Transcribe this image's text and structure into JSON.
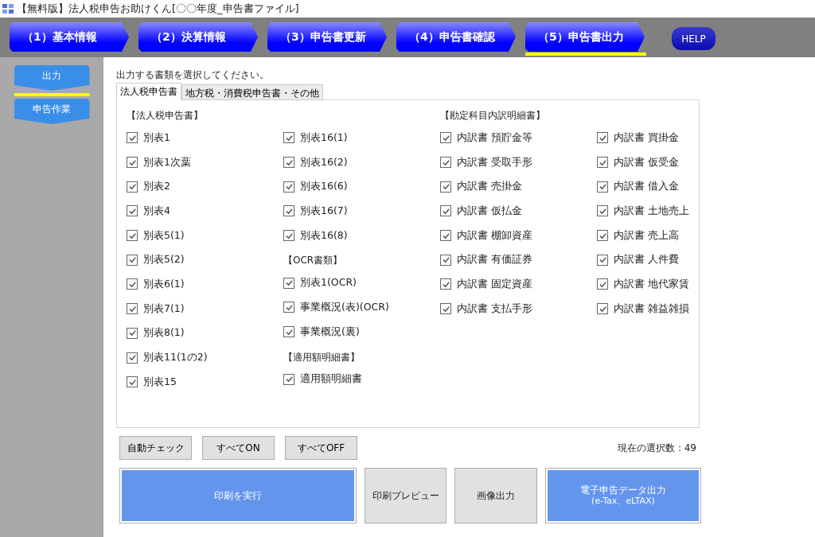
{
  "window": {
    "title": "【無料版】法人税申告お助けくん[〇〇年度_申告書ファイル]"
  },
  "steps": [
    {
      "label": "（1）基本情報",
      "selected": false
    },
    {
      "label": "（2）決算情報",
      "selected": false
    },
    {
      "label": "（3）申告書更新",
      "selected": false
    },
    {
      "label": "（4）申告書確認",
      "selected": false
    },
    {
      "label": "（5）申告書出力",
      "selected": true
    }
  ],
  "help_button": "HELP",
  "sidebar": {
    "items": [
      {
        "label": "出力",
        "selected": true
      },
      {
        "label": "申告作業",
        "selected": false
      }
    ]
  },
  "instruction": "出力する書類を選択してください。",
  "tabs": [
    {
      "label": "法人税申告書",
      "selected": true
    },
    {
      "label": "地方税・消費税申告書・その他",
      "selected": false
    }
  ],
  "columns": [
    {
      "sections": [
        {
          "heading": "【法人税申告書】",
          "items": [
            {
              "label": "別表1",
              "checked": true
            },
            {
              "label": "別表1次葉",
              "checked": true
            },
            {
              "label": "別表2",
              "checked": true
            },
            {
              "label": "別表4",
              "checked": true
            },
            {
              "label": "別表5(1)",
              "checked": true
            },
            {
              "label": "別表5(2)",
              "checked": true
            },
            {
              "label": "別表6(1)",
              "checked": true
            },
            {
              "label": "別表7(1)",
              "checked": true
            },
            {
              "label": "別表8(1)",
              "checked": true
            },
            {
              "label": "別表11(1の2)",
              "checked": true
            },
            {
              "label": "別表15",
              "checked": true
            }
          ]
        }
      ]
    },
    {
      "sections": [
        {
          "items": [
            {
              "label": "別表16(1)",
              "checked": true
            },
            {
              "label": "別表16(2)",
              "checked": true
            },
            {
              "label": "別表16(6)",
              "checked": true
            },
            {
              "label": "別表16(7)",
              "checked": true
            },
            {
              "label": "別表16(8)",
              "checked": true
            }
          ]
        },
        {
          "heading": "【OCR書類】",
          "items": [
            {
              "label": "別表1(OCR)",
              "checked": true
            },
            {
              "label": "事業概況(表)(OCR)",
              "checked": true
            },
            {
              "label": "事業概況(裏)",
              "checked": true
            }
          ]
        },
        {
          "heading": "【適用額明細書】",
          "items": [
            {
              "label": "適用額明細書",
              "checked": true
            }
          ]
        }
      ]
    },
    {
      "sections": [
        {
          "heading": "【勘定科目内訳明細書】",
          "items": [
            {
              "label": "内訳書 預貯金等",
              "checked": true
            },
            {
              "label": "内訳書 受取手形",
              "checked": true
            },
            {
              "label": "内訳書 売掛金",
              "checked": true
            },
            {
              "label": "内訳書 仮払金",
              "checked": true
            },
            {
              "label": "内訳書 棚卸資産",
              "checked": true
            },
            {
              "label": "内訳書 有価証券",
              "checked": true
            },
            {
              "label": "内訳書 固定資産",
              "checked": true
            },
            {
              "label": "内訳書 支払手形",
              "checked": true
            }
          ]
        }
      ]
    },
    {
      "sections": [
        {
          "items": [
            {
              "label": "内訳書 買掛金",
              "checked": true
            },
            {
              "label": "内訳書 仮受金",
              "checked": true
            },
            {
              "label": "内訳書 借入金",
              "checked": true
            },
            {
              "label": "内訳書 土地売上",
              "checked": true
            },
            {
              "label": "内訳書 売上高",
              "checked": true
            },
            {
              "label": "内訳書 人件費",
              "checked": true
            },
            {
              "label": "内訳書 地代家賃",
              "checked": true
            },
            {
              "label": "内訳書 雑益雑損",
              "checked": true
            }
          ]
        }
      ]
    }
  ],
  "quick_buttons": [
    "自動チェック",
    "すべてON",
    "すべてOFF"
  ],
  "selection_count": "現在の選択数：49",
  "action_buttons": [
    {
      "label": "印刷を実行",
      "kind": "primary"
    },
    {
      "label": "印刷プレビュー",
      "kind": "secondary"
    },
    {
      "label": "画像出力",
      "kind": "secondary"
    },
    {
      "label": "電子申告データ出力",
      "sublabel": "(e-Tax、eLTAX)",
      "kind": "primary"
    }
  ]
}
